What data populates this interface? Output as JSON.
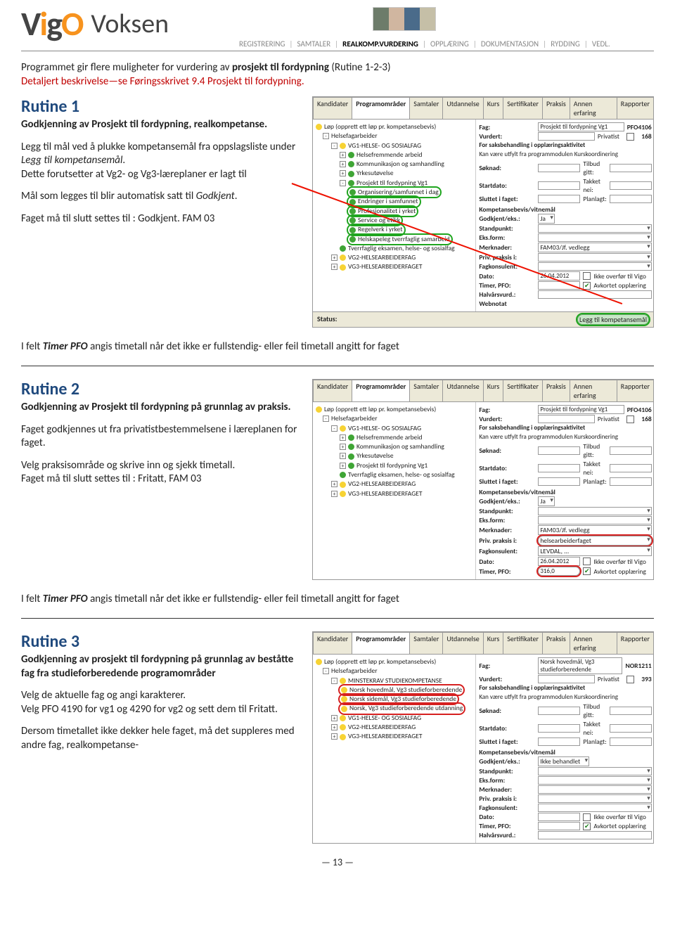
{
  "header": {
    "logo_prefix": "V",
    "logo_i": "i",
    "logo_g": "g",
    "logo_o": "O",
    "logo_voksen": "Voksen"
  },
  "breadcrumb": {
    "items": [
      "REGISTRERING",
      "SAMTALER",
      "REALKOMP.VURDERING",
      "OPPLÆRING",
      "DOKUMENTASJON",
      "RYDDING",
      "VEDL."
    ]
  },
  "intro": {
    "line1_a": "Programmet gir flere muligheter for vurdering av ",
    "line1_b": "prosjekt til fordypning",
    "line1_c": " (Rutine 1-2-3)",
    "line2": "Detaljert beskrivelse—se Føringsskrivet 9.4 Prosjekt til fordypning."
  },
  "rutine1": {
    "title": "Rutine 1",
    "sub": "Godkjenning av Prosjekt til fordypning, realkompetanse.",
    "p1a": "Legg til mål ved å plukke kompetansemål fra oppslagsliste under ",
    "p1b": "Legg til kompetansemål",
    "p1c": ".",
    "p2": "Dette forutsetter at Vg2- og Vg3-læreplaner er lagt til",
    "p3a": "Mål som legges til blir automatisk satt til ",
    "p3b": "Godkjent",
    "p3c": ".",
    "p4": "Faget må til slutt settes til : Godkjent. FAM 03"
  },
  "after_note": {
    "a": "I felt ",
    "b": "Timer PFO",
    "c": " angis timetall når det ikke er fullstendig- eller feil timetall angitt for faget"
  },
  "rutine2": {
    "title": "Rutine 2",
    "sub": "Godkjenning av Prosjekt til fordypning på grunnlag av praksis.",
    "p1": "Faget godkjennes ut fra privatistbestemmelsene i læreplanen for faget.",
    "p2": "Velg praksisområde og skrive inn og sjekk timetall.",
    "p3": "Faget må til slutt settes til : Fritatt, FAM 03"
  },
  "rutine3": {
    "title": "Rutine 3",
    "sub": "Godkjenning av prosjekt til fordypning på grunnlag av beståtte fag fra studieforberedende programområder",
    "p1": "Velg de aktuelle fag og angi karakterer.",
    "p2": "Velg PFO 4190 for vg1  og 4290 for vg2 og sett dem til Fritatt.",
    "p3": "Dersom timetallet ikke dekker hele faget, må det suppleres med andre fag, realkompetanse-"
  },
  "scr_tabs": [
    "Kandidater",
    "Programområder",
    "Samtaler",
    "Utdannelse",
    "Kurs",
    "Sertifikater",
    "Praksis",
    "Annen erfaring",
    "Rapporter"
  ],
  "scr1": {
    "tree_top": "Løp (opprett ett løp pr. kompetansebevis)",
    "tree": [
      "Helsefagarbeider",
      "VG1-HELSE- OG SOSIALFAG",
      "Helsefremmende arbeid",
      "Kommunikasjon og samhandling",
      "Yrkesutøvelse",
      "Prosjekt til fordypning Vg1",
      "Organisering/samfunnet i dag",
      "Endringer i samfunnet",
      "Profesjonalitet i yrket",
      "Service og etikk",
      "Regelverk i yrket",
      "Helskapeleg tverrfaglig samarbeid",
      "Tverrfaglig eksamen, helse- og sosialfag",
      "VG2-HELSEARBEIDERFAG",
      "VG3-HELSEARBEIDERFAGET"
    ],
    "form": {
      "fag": "Fag:",
      "fag_v": "Prosjekt til fordypning Vg1",
      "code": "PFO4106",
      "vurdert": "Vurdert:",
      "priv": "Privatist",
      "priv_v": "168",
      "saksb": "For saksbehandling i opplæringsaktivitet",
      "kanv": "Kan være utfylt fra programmodulen Kurskoordinering",
      "soknad": "Søknad:",
      "tilbud": "Tilbud gitt:",
      "start": "Startdato:",
      "takket": "Takket nei:",
      "sluttet": "Sluttet i faget:",
      "planlagt": "Planlagt:",
      "komp": "Kompetansebevis/vitnemål",
      "godkj": "Godkjent/eks.:",
      "godkj_v": "Ja",
      "standp": "Standpunkt:",
      "eksform": "Eks.form:",
      "merk": "Merknader:",
      "merk_v": "FAM03/Jf. vedlegg",
      "privp": "Priv. praksis i:",
      "fagk": "Fagkonsulent:",
      "dato": "Dato:",
      "dato_v": "26.04.2012",
      "ikkeov": "Ikke overfør til Vigo",
      "timer": "Timer, PFO:",
      "avk": "Avkortet opplæring",
      "halv": "Halvårsvurd.:",
      "webn": "Webnotat",
      "status": "Status:",
      "btn": "Legg til kompetansemål"
    }
  },
  "scr2": {
    "tree": [
      "Helsefagarbeider",
      "VG1-HELSE- OG SOSIALFAG",
      "Helsefremmende arbeid",
      "Kommunikasjon og samhandling",
      "Yrkesutøvelse",
      "Prosjekt til fordypning Vg1",
      "Tverrfaglig eksamen, helse- og sosialfag",
      "VG2-HELSEARBEIDERFAG",
      "VG3-HELSEARBEIDERFAGET"
    ],
    "form": {
      "privp_v": "helsearbeiderfaget",
      "fagk_v": "LEVDAL, ...",
      "timer_v": "316,0"
    }
  },
  "scr3": {
    "tree": [
      "Helsefagarbeider",
      "MINSTEKRAV STUDIEKOMPETANSE",
      "Norsk hovedmål, Vg3 studieforberedende",
      "Norsk sidemål, Vg3 studieforberedende",
      "Norsk, Vg3 studieforberedende utdanning",
      "VG1-HELSE- OG SOSIALFAG",
      "VG2-HELSEARBEIDERFAG",
      "VG3-HELSEARBEIDERFAGET"
    ],
    "form": {
      "fag_v": "Norsk hovedmål, Vg3 studieforberedende",
      "code": "NOR1211",
      "priv_v": "393",
      "godkj_v": "Ikke behandlet"
    }
  },
  "page": "— 13 —"
}
